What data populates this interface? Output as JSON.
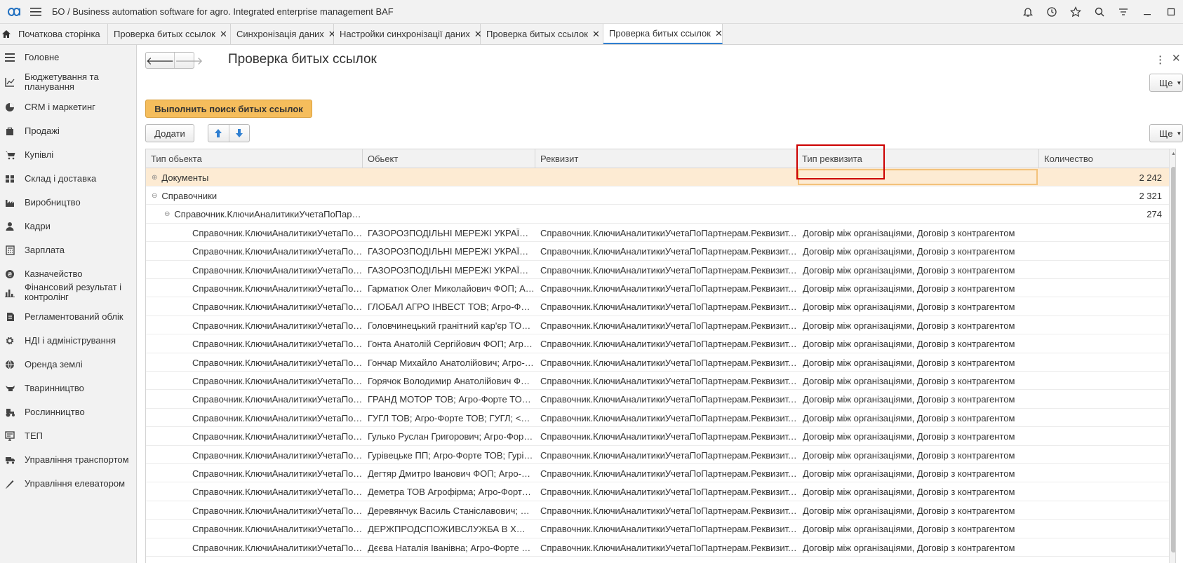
{
  "app": {
    "title": "БО / Business automation software for agro. Integrated enterprise management BAF"
  },
  "tabs": [
    {
      "label": "Початкова сторінка",
      "closable": false
    },
    {
      "label": "Проверка битых ссылок",
      "closable": true
    },
    {
      "label": "Синхронізація даних",
      "closable": true
    },
    {
      "label": "Настройки синхронізації даних",
      "closable": true
    },
    {
      "label": "Проверка битых ссылок",
      "closable": true
    },
    {
      "label": "Проверка битых ссылок",
      "closable": true,
      "active": true
    }
  ],
  "sidebar": {
    "items": [
      {
        "label": "Головне",
        "icon": "menu-icon"
      },
      {
        "label": "Бюджетування та\nпланування",
        "icon": "chart-line-icon"
      },
      {
        "label": "CRM і маркетинг",
        "icon": "pie-icon"
      },
      {
        "label": "Продажі",
        "icon": "bag-icon"
      },
      {
        "label": "Купівлі",
        "icon": "cart-icon"
      },
      {
        "label": "Склад і доставка",
        "icon": "warehouse-icon"
      },
      {
        "label": "Виробництво",
        "icon": "factory-icon"
      },
      {
        "label": "Кадри",
        "icon": "person-icon"
      },
      {
        "label": "Зарплата",
        "icon": "calculator-icon"
      },
      {
        "label": "Казначейство",
        "icon": "coin-icon"
      },
      {
        "label": "Фінансовий результат і\nконтролінг",
        "icon": "bar-chart-icon"
      },
      {
        "label": "Регламентований облік",
        "icon": "book-icon"
      },
      {
        "label": "НДІ і адміністрування",
        "icon": "gear-icon"
      },
      {
        "label": "Оренда землі",
        "icon": "globe-icon"
      },
      {
        "label": "Тваринництво",
        "icon": "cow-icon"
      },
      {
        "label": "Рослинництво",
        "icon": "tractor-icon"
      },
      {
        "label": "ТЕП",
        "icon": "monitor-icon"
      },
      {
        "label": "Управління транспортом",
        "icon": "truck-icon"
      },
      {
        "label": "Управління елеватором",
        "icon": "pen-icon"
      }
    ]
  },
  "main": {
    "title": "Проверка битых ссылок",
    "more_label": "Ще",
    "run_button": "Выполнить поиск битых ссылок",
    "add_button": "Додати",
    "columns": [
      "Тип обьекта",
      "Обьект",
      "Реквизит",
      "Тип реквизита",
      "Количество"
    ],
    "groups": [
      {
        "label": "Документы",
        "count": "2 242"
      },
      {
        "label": "Справочники",
        "count": "2 321"
      },
      {
        "label": "Справочник.КлючиАналитикиУчетаПоПар…",
        "count": "274"
      }
    ],
    "rows": [
      {
        "type": "Справочник.КлючиАналитикиУчетаПо…",
        "object": "ГАЗОРОЗПОДІЛЬНІ МЕРЕЖІ УКРАЇ…",
        "attr": "Справочник.КлючиАналитикиУчетаПоПартнерам.Реквизит.…",
        "attr_type": "Договір між організаціями, Договір з контрагентом"
      },
      {
        "type": "Справочник.КлючиАналитикиУчетаПо…",
        "object": "ГАЗОРОЗПОДІЛЬНІ МЕРЕЖІ УКРАЇ…",
        "attr": "Справочник.КлючиАналитикиУчетаПоПартнерам.Реквизит.…",
        "attr_type": "Договір між організаціями, Договір з контрагентом"
      },
      {
        "type": "Справочник.КлючиАналитикиУчетаПо…",
        "object": "ГАЗОРОЗПОДІЛЬНІ МЕРЕЖІ УКРАЇ…",
        "attr": "Справочник.КлючиАналитикиУчетаПоПартнерам.Реквизит.…",
        "attr_type": "Договір між організаціями, Договір з контрагентом"
      },
      {
        "type": "Справочник.КлючиАналитикиУчетаПо…",
        "object": "Гарматюк Олег Миколайович ФОП; А…",
        "attr": "Справочник.КлючиАналитикиУчетаПоПартнерам.Реквизит.…",
        "attr_type": "Договір між організаціями, Договір з контрагентом"
      },
      {
        "type": "Справочник.КлючиАналитикиУчетаПо…",
        "object": "ГЛОБАЛ АГРО ІНВЕСТ ТОВ; Агро-Ф…",
        "attr": "Справочник.КлючиАналитикиУчетаПоПартнерам.Реквизит.…",
        "attr_type": "Договір між організаціями, Договір з контрагентом"
      },
      {
        "type": "Справочник.КлючиАналитикиУчетаПо…",
        "object": "Головчинецький гранітний кар'єр ТО…",
        "attr": "Справочник.КлючиАналитикиУчетаПоПартнерам.Реквизит.…",
        "attr_type": "Договір між організаціями, Договір з контрагентом"
      },
      {
        "type": "Справочник.КлючиАналитикиУчетаПо…",
        "object": "Гонта Анатолій Сергійович ФОП; Агр…",
        "attr": "Справочник.КлючиАналитикиУчетаПоПартнерам.Реквизит.…",
        "attr_type": "Договір між організаціями, Договір з контрагентом"
      },
      {
        "type": "Справочник.КлючиАналитикиУчетаПо…",
        "object": "Гончар Михайло Анатолійович; Агро-…",
        "attr": "Справочник.КлючиАналитикиУчетаПоПартнерам.Реквизит.…",
        "attr_type": "Договір між організаціями, Договір з контрагентом"
      },
      {
        "type": "Справочник.КлючиАналитикиУчетаПо…",
        "object": "Горячок Володимир Анатолійович Ф…",
        "attr": "Справочник.КлючиАналитикиУчетаПоПартнерам.Реквизит.…",
        "attr_type": "Договір між організаціями, Договір з контрагентом"
      },
      {
        "type": "Справочник.КлючиАналитикиУчетаПо…",
        "object": "ГРАНД МОТОР ТОВ; Агро-Форте ТО…",
        "attr": "Справочник.КлючиАналитикиУчетаПоПартнерам.Реквизит.…",
        "attr_type": "Договір між організаціями, Договір з контрагентом"
      },
      {
        "type": "Справочник.КлючиАналитикиУчетаПо…",
        "object": "ГУГЛ ТОВ; Агро-Форте ТОВ; ГУГЛ; <…",
        "attr": "Справочник.КлючиАналитикиУчетаПоПартнерам.Реквизит.…",
        "attr_type": "Договір між організаціями, Договір з контрагентом"
      },
      {
        "type": "Справочник.КлючиАналитикиУчетаПо…",
        "object": "Гулько Руслан Григорович; Агро-Фор…",
        "attr": "Справочник.КлючиАналитикиУчетаПоПартнерам.Реквизит.…",
        "attr_type": "Договір між організаціями, Договір з контрагентом"
      },
      {
        "type": "Справочник.КлючиАналитикиУчетаПо…",
        "object": "Гурівецьке ПП; Агро-Форте ТОВ; Гурі…",
        "attr": "Справочник.КлючиАналитикиУчетаПоПартнерам.Реквизит.…",
        "attr_type": "Договір між організаціями, Договір з контрагентом"
      },
      {
        "type": "Справочник.КлючиАналитикиУчетаПо…",
        "object": "Дегтяр Дмитро Іванович ФОП; Агро-…",
        "attr": "Справочник.КлючиАналитикиУчетаПоПартнерам.Реквизит.…",
        "attr_type": "Договір між організаціями, Договір з контрагентом"
      },
      {
        "type": "Справочник.КлючиАналитикиУчетаПо…",
        "object": "Деметра ТОВ Агрофірма; Агро-Форт…",
        "attr": "Справочник.КлючиАналитикиУчетаПоПартнерам.Реквизит.…",
        "attr_type": "Договір між організаціями, Договір з контрагентом"
      },
      {
        "type": "Справочник.КлючиАналитикиУчетаПо…",
        "object": "Деревянчук Василь Станіславович; …",
        "attr": "Справочник.КлючиАналитикиУчетаПоПартнерам.Реквизит.…",
        "attr_type": "Договір між організаціями, Договір з контрагентом"
      },
      {
        "type": "Справочник.КлючиАналитикиУчетаПо…",
        "object": "ДЕРЖПРОДСПОЖИВСЛУЖБА В Х…",
        "attr": "Справочник.КлючиАналитикиУчетаПоПартнерам.Реквизит.…",
        "attr_type": "Договір між організаціями, Договір з контрагентом"
      },
      {
        "type": "Справочник.КлючиАналитикиУчетаПо…",
        "object": "Дєєва Наталія Іванівна; Агро-Форте …",
        "attr": "Справочник.КлючиАналитикиУчетаПоПартнерам.Реквизит.…",
        "attr_type": "Договір між організаціями, Договір з контрагентом"
      }
    ]
  },
  "colors": {
    "accent": "#2f7fd1",
    "primary_button": "#f5bd5c",
    "selected_row": "#fdebd3",
    "highlight_box": "#cc0000"
  }
}
